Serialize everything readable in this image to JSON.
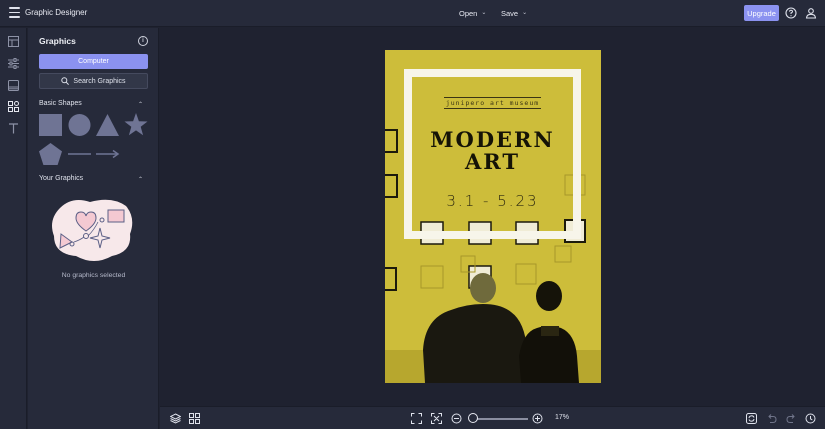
{
  "app": {
    "title": "Graphic Designer"
  },
  "toolbar": {
    "open_label": "Open",
    "save_label": "Save",
    "upgrade_label": "Upgrade",
    "icons": [
      "menu-icon",
      "help-icon",
      "user-icon"
    ]
  },
  "rail": {
    "icons": [
      "templates-icon",
      "adjust-icon",
      "image-icon",
      "graphics-icon",
      "text-icon"
    ],
    "active_index": 3
  },
  "panel": {
    "title": "Graphics",
    "computer_button": "Computer",
    "search_button": "Search Graphics",
    "basic_shapes_label": "Basic Shapes",
    "shapes": [
      "square",
      "circle",
      "triangle",
      "star",
      "pentagon",
      "line",
      "arrow"
    ],
    "your_graphics_label": "Your Graphics",
    "empty_caption": "No graphics selected"
  },
  "poster": {
    "subtitle": "junipero art museum",
    "title_line1": "MODERN",
    "title_line2": "ART",
    "date": "3.1 - 5.23",
    "background_color": "#cdbd3a"
  },
  "bottombar": {
    "zoom_label": "17%",
    "zoom_value": 0.05,
    "icons": [
      "layers-icon",
      "grid-icon",
      "fit-screen-icon",
      "fit-width-icon",
      "zoom-out-icon",
      "zoom-in-icon",
      "sync-icon",
      "undo-icon",
      "redo-icon",
      "history-icon"
    ]
  },
  "colors": {
    "accent": "#8b92f0",
    "panel": "#262a3a",
    "background": "#1f2230"
  }
}
